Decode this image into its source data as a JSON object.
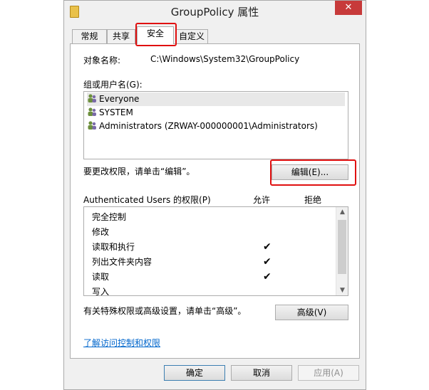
{
  "window": {
    "title": "GroupPolicy 属性",
    "close_glyph": "✕"
  },
  "tabs": [
    {
      "label": "常规"
    },
    {
      "label": "共享"
    },
    {
      "label": "安全"
    },
    {
      "label": "自定义"
    }
  ],
  "security": {
    "object_label": "对象名称:",
    "object_value": "C:\\Windows\\System32\\GroupPolicy",
    "groups_label": "组或用户名(G):",
    "groups": [
      {
        "name": "Everyone",
        "icon": "users-icon"
      },
      {
        "name": "SYSTEM",
        "icon": "users-icon"
      },
      {
        "name": "Administrators (ZRWAY-000000001\\Administrators)",
        "icon": "users-icon"
      }
    ],
    "change_hint": "要更改权限，请单击“编辑”。",
    "edit_button": "编辑(E)...",
    "permissions_label": "Authenticated Users 的权限(P)",
    "allow_header": "允许",
    "deny_header": "拒绝",
    "permissions": [
      {
        "name": "完全控制",
        "allow": "",
        "deny": ""
      },
      {
        "name": "修改",
        "allow": "",
        "deny": ""
      },
      {
        "name": "读取和执行",
        "allow": "✔",
        "deny": ""
      },
      {
        "name": "列出文件夹内容",
        "allow": "✔",
        "deny": ""
      },
      {
        "name": "读取",
        "allow": "✔",
        "deny": ""
      },
      {
        "name": "写入",
        "allow": "",
        "deny": ""
      }
    ],
    "advanced_hint": "有关特殊权限或高级设置，请单击“高级”。",
    "advanced_button": "高级(V)",
    "learn_link": "了解访问控制和权限"
  },
  "footer": {
    "ok": "确定",
    "cancel": "取消",
    "apply": "应用(A)"
  },
  "colors": {
    "highlight_box": "#e01010",
    "link": "#0066cc"
  }
}
